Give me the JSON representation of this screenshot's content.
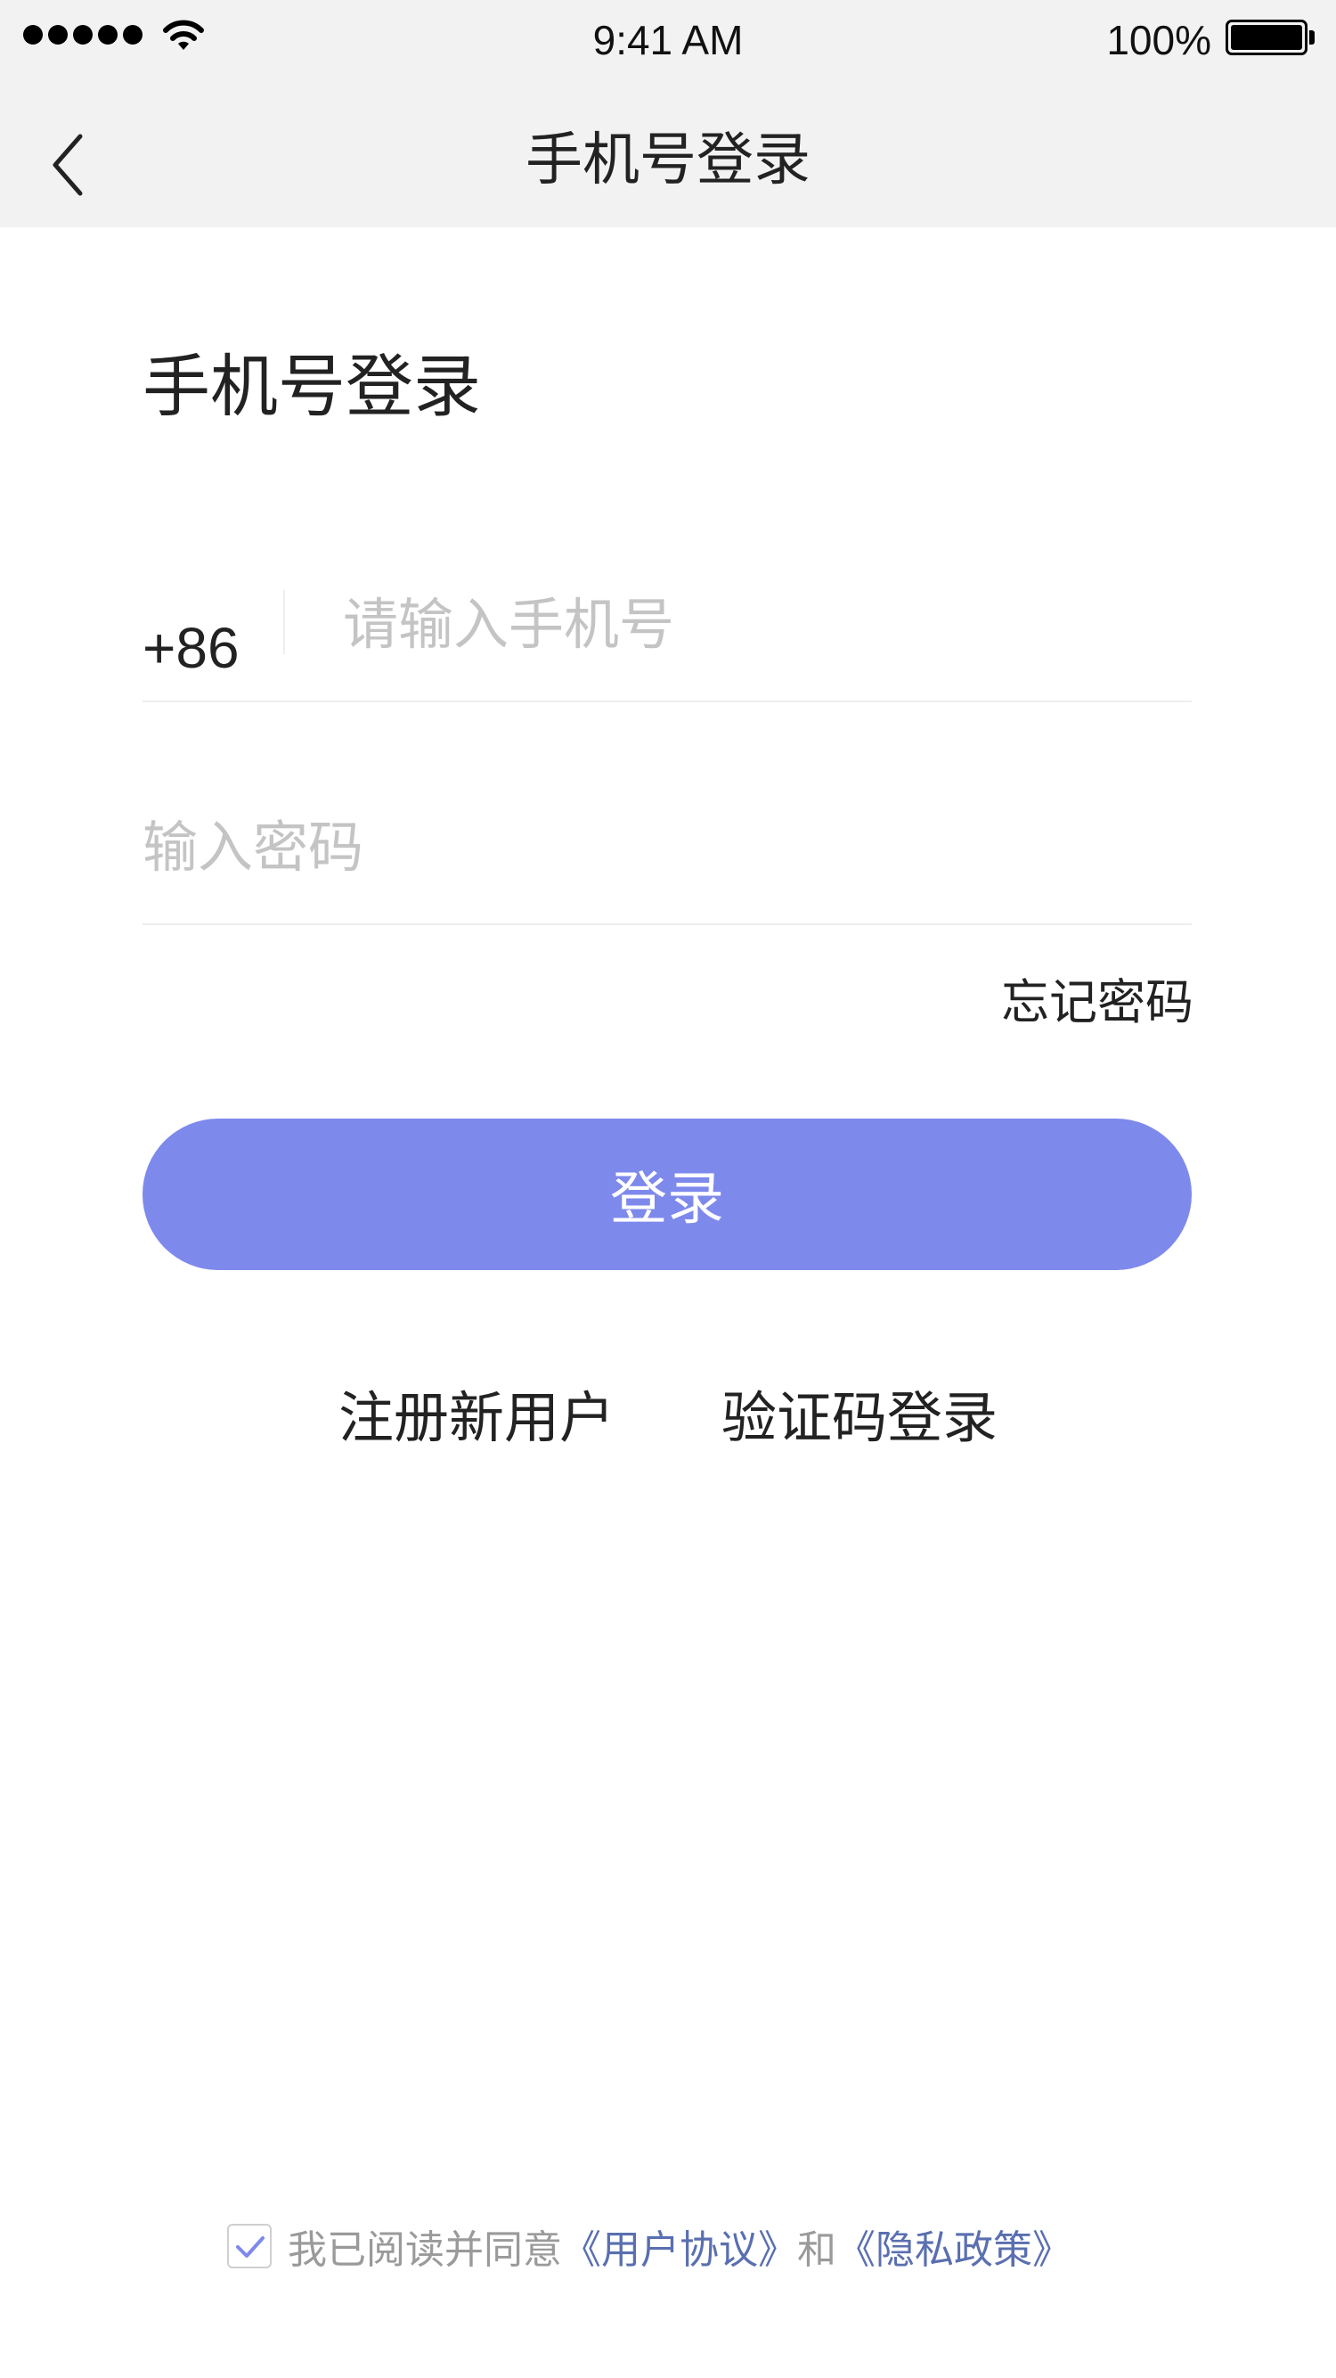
{
  "status_bar": {
    "time": "9:41 AM",
    "battery": "100%"
  },
  "nav": {
    "title": "手机号登录",
    "back_icon": "chevron-left-icon"
  },
  "form": {
    "heading": "手机号登录",
    "country_code": "+86",
    "phone_placeholder": "请输入手机号",
    "phone_value": "",
    "password_placeholder": "输入密码",
    "password_value": "",
    "forgot_password": "忘记密码",
    "login_button": "登录",
    "login_button_color": "#7e89ec"
  },
  "links": {
    "register": "注册新用户",
    "sms_login": "验证码登录"
  },
  "agreement": {
    "checked": true,
    "prefix": "我已阅读并同意",
    "user_agreement": "《用户协议》",
    "and": "和",
    "privacy_policy": "《隐私政策》",
    "link_color": "#5a6fb0"
  }
}
